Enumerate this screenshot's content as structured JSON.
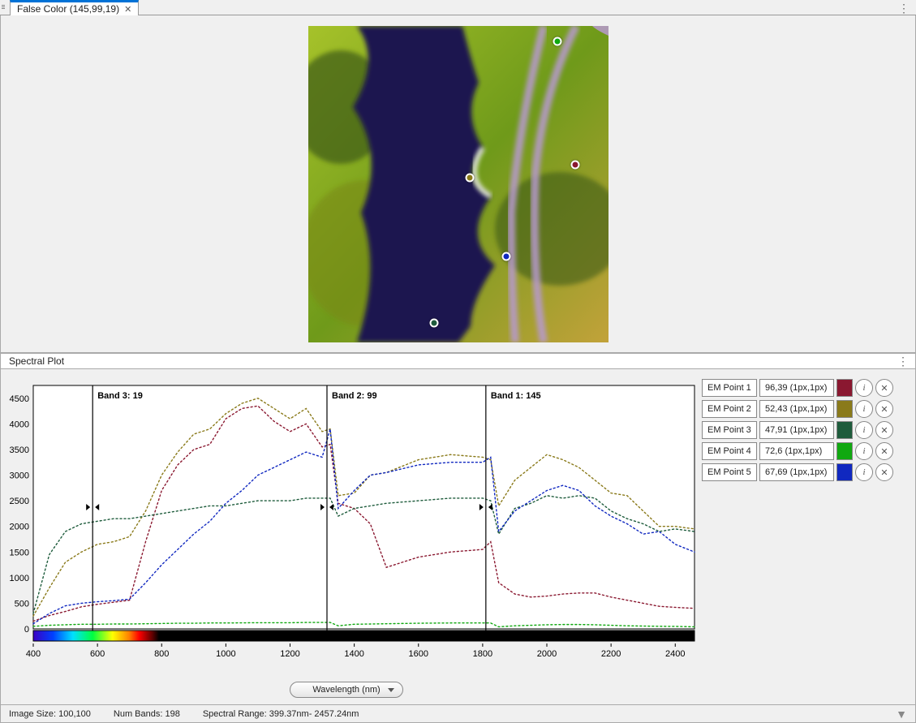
{
  "tab": {
    "title": "False Color (145,99,19)"
  },
  "spectral_header": "Spectral Plot",
  "xaxis_dropdown": "Wavelength (nm)",
  "bands": {
    "b1": {
      "label": "Band 1: 145",
      "x_nm": 1810
    },
    "b2": {
      "label": "Band 2: 99",
      "x_nm": 1315
    },
    "b3": {
      "label": "Band 3: 19",
      "x_nm": 585
    }
  },
  "image_points": [
    {
      "color": "#8a1830",
      "nx": 0.89,
      "ny": 0.44
    },
    {
      "color": "#8a7a1a",
      "nx": 0.54,
      "ny": 0.48
    },
    {
      "color": "#1e5c3c",
      "nx": 0.42,
      "ny": 0.94
    },
    {
      "color": "#10a810",
      "nx": 0.83,
      "ny": 0.05
    },
    {
      "color": "#1028c0",
      "nx": 0.66,
      "ny": 0.73
    }
  ],
  "em_points": [
    {
      "name": "EM Point 1",
      "coords": "96,39 (1px,1px)",
      "color": "#8a1830"
    },
    {
      "name": "EM Point 2",
      "coords": "52,43 (1px,1px)",
      "color": "#8a7a1a"
    },
    {
      "name": "EM Point 3",
      "coords": "47,91 (1px,1px)",
      "color": "#1e5c3c"
    },
    {
      "name": "EM Point 4",
      "coords": "72,6 (1px,1px)",
      "color": "#10a810"
    },
    {
      "name": "EM Point 5",
      "coords": "67,69 (1px,1px)",
      "color": "#1028c0"
    }
  ],
  "status": {
    "size": "Image Size: 100,100",
    "bands": "Num Bands: 198",
    "range": "Spectral Range: 399.37nm- 2457.24nm"
  },
  "chart_data": {
    "type": "line",
    "xlabel": "Wavelength (nm)",
    "ylabel": "",
    "xlim": [
      400,
      2460
    ],
    "ylim": [
      0,
      4750
    ],
    "xticks": [
      400,
      600,
      800,
      1000,
      1200,
      1400,
      1600,
      1800,
      2000,
      2200,
      2400
    ],
    "yticks": [
      0,
      500,
      1000,
      1500,
      2000,
      2500,
      3000,
      3500,
      4000,
      4500
    ],
    "band_markers": [
      {
        "label": "Band 3: 19",
        "x": 585
      },
      {
        "label": "Band 2: 99",
        "x": 1315
      },
      {
        "label": "Band 1: 145",
        "x": 1810
      }
    ],
    "x": [
      400,
      450,
      500,
      550,
      600,
      650,
      700,
      750,
      800,
      850,
      900,
      950,
      1000,
      1050,
      1100,
      1150,
      1200,
      1250,
      1300,
      1325,
      1350,
      1400,
      1450,
      1500,
      1600,
      1700,
      1800,
      1825,
      1850,
      1900,
      1950,
      2000,
      2050,
      2100,
      2150,
      2200,
      2250,
      2300,
      2350,
      2400,
      2460
    ],
    "series": [
      {
        "name": "EM Point 1",
        "color": "#8a1830",
        "values": [
          150,
          260,
          340,
          430,
          480,
          520,
          560,
          1700,
          2700,
          3200,
          3500,
          3600,
          4100,
          4300,
          4350,
          4050,
          3850,
          4000,
          3550,
          3600,
          2450,
          2350,
          2050,
          1200,
          1400,
          1500,
          1550,
          1700,
          900,
          680,
          620,
          640,
          680,
          700,
          700,
          620,
          560,
          500,
          440,
          420,
          400
        ]
      },
      {
        "name": "EM Point 2",
        "color": "#8a7a1a",
        "values": [
          250,
          800,
          1300,
          1500,
          1650,
          1700,
          1800,
          2300,
          3000,
          3450,
          3800,
          3900,
          4200,
          4400,
          4500,
          4300,
          4100,
          4300,
          3850,
          3900,
          2600,
          2650,
          3000,
          3050,
          3300,
          3400,
          3350,
          3300,
          2400,
          2900,
          3150,
          3400,
          3300,
          3150,
          2900,
          2650,
          2600,
          2300,
          2000,
          2000,
          1950
        ]
      },
      {
        "name": "EM Point 3",
        "color": "#1e5c3c",
        "values": [
          300,
          1450,
          1900,
          2050,
          2100,
          2150,
          2150,
          2200,
          2250,
          2300,
          2350,
          2400,
          2400,
          2450,
          2500,
          2500,
          2500,
          2550,
          2550,
          2550,
          2200,
          2350,
          2400,
          2450,
          2500,
          2550,
          2550,
          2500,
          1850,
          2350,
          2450,
          2600,
          2550,
          2600,
          2550,
          2300,
          2150,
          2050,
          1900,
          1950,
          1900
        ]
      },
      {
        "name": "EM Point 4",
        "color": "#10a810",
        "values": [
          50,
          70,
          80,
          90,
          90,
          95,
          95,
          100,
          105,
          110,
          110,
          115,
          115,
          118,
          120,
          120,
          120,
          125,
          125,
          125,
          60,
          90,
          95,
          100,
          110,
          115,
          115,
          115,
          40,
          60,
          70,
          80,
          85,
          85,
          80,
          70,
          60,
          55,
          50,
          48,
          40
        ]
      },
      {
        "name": "EM Point 5",
        "color": "#1028c0",
        "values": [
          100,
          300,
          450,
          500,
          530,
          550,
          580,
          900,
          1250,
          1550,
          1850,
          2100,
          2450,
          2700,
          3000,
          3150,
          3300,
          3450,
          3350,
          3900,
          2350,
          2700,
          3000,
          3050,
          3200,
          3250,
          3250,
          3350,
          1900,
          2300,
          2500,
          2700,
          2800,
          2700,
          2400,
          2200,
          2050,
          1850,
          1900,
          1650,
          1500
        ]
      }
    ]
  }
}
